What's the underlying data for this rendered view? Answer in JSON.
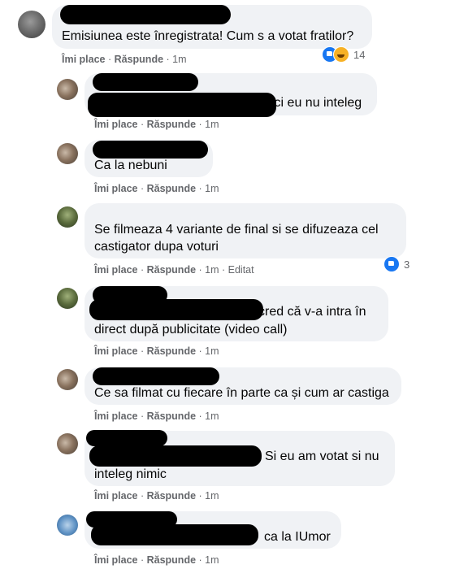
{
  "comments": [
    {
      "text": [
        "Emisiunea este înregistrata! Cum s a votat fratilor?"
      ],
      "like": "Îmi place",
      "reply": "Răspunde",
      "time": "1m",
      "edited": "",
      "reactions": "14"
    },
    {
      "text": [
        "ici eu nu inteleg"
      ],
      "like": "Îmi place",
      "reply": "Răspunde",
      "time": "1m",
      "edited": "",
      "reactions": ""
    },
    {
      "text": [
        "Ca la nebuni"
      ],
      "like": "Îmi place",
      "reply": "Răspunde",
      "time": "1m",
      "edited": "",
      "reactions": ""
    },
    {
      "text": [
        "Se filmeaza 4 variante de final si se difuzeaza cel",
        "castigator dupa voturi"
      ],
      "like": "Îmi place",
      "reply": "Răspunde",
      "time": "1m",
      "edited": "Editat",
      "reactions": "3"
    },
    {
      "text": [
        "cred că v-a intra în",
        "direct după publicitate (video call)"
      ],
      "like": "Îmi place",
      "reply": "Răspunde",
      "time": "1m",
      "edited": "",
      "reactions": ""
    },
    {
      "text": [
        "Ce sa filmat cu fiecare în parte ca și cum ar castiga"
      ],
      "like": "Îmi place",
      "reply": "Răspunde",
      "time": "1m",
      "edited": "",
      "reactions": ""
    },
    {
      "text": [
        "Si eu am votat si nu",
        "inteleg nimic"
      ],
      "like": "Îmi place",
      "reply": "Răspunde",
      "time": "1m",
      "edited": "",
      "reactions": ""
    },
    {
      "text": [
        "ca la IUmor"
      ],
      "like": "Îmi place",
      "reply": "Răspunde",
      "time": "1m",
      "edited": "",
      "reactions": ""
    }
  ],
  "colors": {
    "bubble": "#f0f2f5",
    "meta": "#65676b",
    "like_blue": "#1877f2",
    "haha_yellow": "#f7b125",
    "redaction": "#000000"
  },
  "icons": [
    "like-reaction-icon",
    "haha-reaction-icon"
  ]
}
